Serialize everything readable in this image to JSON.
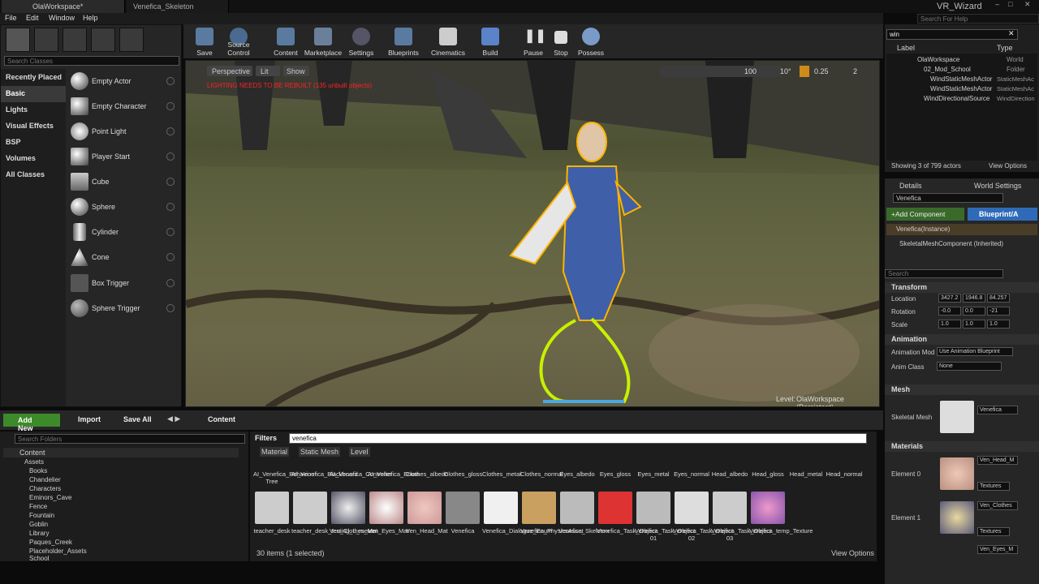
{
  "tabs": [
    {
      "label": "OlaWorkspace*"
    },
    {
      "label": "Venefica_Skeleton"
    }
  ],
  "titlebar": {
    "project": "VR_Wizard",
    "search_placeholder": "Search For Help"
  },
  "menu": [
    "File",
    "Edit",
    "Window",
    "Help"
  ],
  "modes": {
    "search_placeholder": "Search Classes",
    "categories": [
      "Recently Placed",
      "Basic",
      "Lights",
      "Visual Effects",
      "BSP",
      "Volumes",
      "All Classes"
    ],
    "items": [
      "Empty Actor",
      "Empty Character",
      "Point Light",
      "Player Start",
      "Cube",
      "Sphere",
      "Cylinder",
      "Cone",
      "Box Trigger",
      "Sphere Trigger"
    ]
  },
  "toolbar": [
    "Save",
    "Source Control",
    "Content",
    "Marketplace",
    "Settings",
    "Blueprints",
    "Cinematics",
    "Build",
    "Pause",
    "Stop",
    "Possess"
  ],
  "viewport": {
    "perspective": "Perspective",
    "lit": "Lit",
    "show": "Show",
    "warning": "LIGHTING NEEDS TO BE REBUILT (135 unbuilt objects)",
    "grid": "100",
    "angle": "10°",
    "scale": "0.25",
    "cam": "2",
    "level_label": "Level:",
    "level_name": "OlaWorkspace (Persistent)"
  },
  "outliner": {
    "search_value": "win",
    "col_label": "Label",
    "col_type": "Type",
    "rows": [
      {
        "label": "OlaWorkspace",
        "type": "World"
      },
      {
        "label": "02_Mod_School",
        "type": "Folder"
      },
      {
        "label": "WindStaticMeshActor",
        "type": "StaticMeshAc"
      },
      {
        "label": "WindStaticMeshActor",
        "type": "StaticMeshAc"
      },
      {
        "label": "WindDirectionalSource",
        "type": "WindDirection"
      }
    ],
    "showing": "Showing 3 of 799 actors",
    "view_options": "View Options"
  },
  "details": {
    "tab_details": "Details",
    "tab_world": "World Settings",
    "name": "Venefica",
    "add_component": "+Add Component",
    "blueprint": "Blueprint/A",
    "instance": "Venefica(Instance)",
    "component": "SkeletalMeshComponent (Inherited)",
    "search_placeholder": "Search",
    "transform": "Transform",
    "location": "Location",
    "rotation": "Rotation",
    "scale": "Scale",
    "loc": [
      "3427.2",
      "1946.8",
      "84.257"
    ],
    "rot": [
      "-0.0",
      "0.0",
      "-21"
    ],
    "scl": [
      "1.0",
      "1.0",
      "1.0"
    ],
    "animation": "Animation",
    "anim_mode": "Animation Mod",
    "anim_mode_val": "Use Animation Blueprint",
    "anim_class": "Anim Class",
    "anim_class_val": "None",
    "mesh": "Mesh",
    "skeletal_mesh": "Skeletal Mesh",
    "mesh_val": "Venefica",
    "materials": "Materials",
    "element0": "Element 0",
    "element1": "Element 1",
    "mat0": "Ven_Head_M",
    "mat1": "Ven_Clothes",
    "mat2": "Ven_Eyes_M",
    "textures": "Textures"
  },
  "content_bar": {
    "add_new": "Add New",
    "import": "Import",
    "save_all": "Save All",
    "path": "Content"
  },
  "folders": {
    "search_placeholder": "Search Folders",
    "tree": [
      "Content",
      "Assets",
      "Books",
      "Chandelier",
      "Characters",
      "Eminors_Cave",
      "Fence",
      "Fountain",
      "Goblin",
      "Library",
      "Paques_Creek",
      "Placeholder_Assets",
      "School"
    ]
  },
  "assets": {
    "filters": "Filters",
    "search_value": "venefica",
    "filter_tabs": [
      "Material",
      "Static Mesh",
      "Level"
    ],
    "row1": [
      "AI_Venefica_Behaviour Tree",
      "AI_Venefica_Blackboard",
      "AI_Venefica_Controller",
      "AI_Venefica_Enum",
      "Clothes_albedo",
      "Clothes_gloss",
      "Clothes_metal",
      "Clothes_normal",
      "Eyes_albedo",
      "Eyes_gloss",
      "Eyes_metal",
      "Eyes_normal",
      "Head_albedo",
      "Head_gloss",
      "Head_metal",
      "Head_normal"
    ],
    "row2": [
      "teacher_desk",
      "teacher_desk_testing_L_meter",
      "Ven_Clothes_Mat",
      "Ven_Eyes_Mat",
      "Ven_Head_Mat",
      "Venefica",
      "Venefica_Dialogue_Enum",
      "Venefica_PhysicsAsset",
      "Venefica_Skeleton",
      "Venefica_Task_Object",
      "Venefica_Task_Object 01",
      "Venefica_Task_Object 02",
      "Venefica_Task_Object 03",
      "Venefica_temp_Texture"
    ],
    "count": "30 items (1 selected)",
    "view_options": "View Options"
  }
}
